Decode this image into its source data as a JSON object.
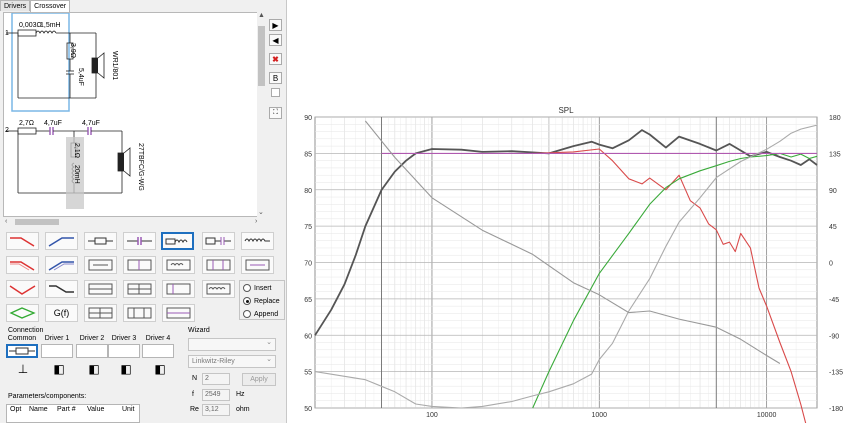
{
  "tabs": [
    {
      "label": "Drivers"
    },
    {
      "label": "Crossover"
    }
  ],
  "schematic": {
    "row1_number": "1",
    "row2_number": "2",
    "r1_label": "0,003Ω",
    "l1_label": "1,5mH",
    "r_shunt1": "3,9Ω",
    "c_shunt1": "5,4uF",
    "driver1_name": "WR1/801",
    "r2_label": "2,7Ω",
    "c2a_label": "4,7uF",
    "c2b_label": "4,7uF",
    "r_shunt2": "2,1Ω",
    "l_shunt2": "20mH",
    "driver2_name": "27TBFC/G-WG"
  },
  "radios": {
    "options": [
      {
        "label": "Insert"
      },
      {
        "label": "Replace"
      },
      {
        "label": "Append"
      }
    ],
    "selected": 1
  },
  "palette_text_button": "G(f)",
  "side_buttons": {
    "b_label": "B"
  },
  "connection": {
    "title": "Connection",
    "tabs": [
      "Common",
      "Driver 1",
      "Driver 2",
      "Driver 3",
      "Driver 4"
    ],
    "selected": 0
  },
  "wizard": {
    "title": "Wizard",
    "type_value": "",
    "filter_value": "Linkwitz-Riley",
    "n_label": "N",
    "n_value": "2",
    "apply_label": "Apply",
    "f_label": "f",
    "f_value": "2549",
    "f_unit": "Hz",
    "re_label": "Re",
    "re_value": "3,12",
    "re_unit": "ohm"
  },
  "params": {
    "title": "Parameters/components:",
    "columns": [
      "Opt",
      "Name",
      "Part #",
      "Value",
      "Unit"
    ]
  },
  "chart_data": {
    "type": "line",
    "title": "SPL",
    "xscale": "log",
    "xlim": [
      20,
      20000
    ],
    "x_tick_labels": [
      "100",
      "1000",
      "10000"
    ],
    "ylim": [
      50,
      90
    ],
    "y_ticks": [
      50,
      55,
      60,
      65,
      70,
      75,
      80,
      85,
      90
    ],
    "y2lim": [
      -180,
      180
    ],
    "y2_ticks": [
      -180,
      -135,
      -90,
      -45,
      0,
      45,
      90,
      135,
      180
    ],
    "grid": true,
    "series": [
      {
        "color": "#555555",
        "x": [
          20,
          25,
          30,
          35,
          40,
          50,
          60,
          70,
          80,
          100,
          150,
          200,
          300,
          500,
          700,
          900,
          1000,
          1200,
          1500,
          1800,
          2000,
          2500,
          3000,
          4000,
          5000,
          6000,
          7000,
          8000,
          10000,
          12000,
          14000,
          16000,
          18000,
          20000
        ],
        "y": [
          60,
          63.5,
          67,
          71,
          75,
          80,
          82.5,
          84,
          85,
          85.6,
          85.5,
          85.2,
          85.3,
          85,
          86,
          86.6,
          86.2,
          85.7,
          86.8,
          88.2,
          87.6,
          85.8,
          87.3,
          86.3,
          85.4,
          86.3,
          85.4,
          84.6,
          85.2,
          84.5,
          84,
          83.4,
          84.2,
          83.4
        ]
      },
      {
        "color": "#d94a4a",
        "x": [
          400,
          700,
          1000,
          1200,
          1500,
          1800,
          2000,
          2500,
          3000,
          3500,
          4000,
          4500,
          5000,
          5500,
          6000,
          6500,
          7000,
          8000,
          9000,
          10000,
          12000,
          14000,
          16000,
          18000
        ],
        "y": [
          85,
          85.2,
          85.6,
          84,
          81.5,
          80.8,
          81.6,
          80,
          82,
          78.5,
          77.5,
          75.3,
          74.5,
          72.5,
          72.8,
          71.5,
          74,
          72,
          66.5,
          64,
          59,
          55,
          50.5,
          46
        ]
      },
      {
        "color": "#3aaa3a",
        "x": [
          400,
          500,
          700,
          1000,
          1500,
          2000,
          2500,
          3000,
          4000,
          5000,
          6000,
          7000,
          8000,
          10000,
          12000,
          14000,
          16000,
          18000,
          20000
        ],
        "y": [
          50,
          55,
          62,
          68.5,
          74,
          78,
          80.3,
          81.5,
          82.6,
          83.3,
          83.9,
          84.3,
          84.5,
          84.7,
          85,
          84.5,
          84.9,
          84.3,
          84.6
        ]
      },
      {
        "color": "#b05ab0",
        "x": [
          50,
          100,
          200,
          500,
          700,
          1000,
          1500,
          2000,
          5000,
          10000,
          20000
        ],
        "y": [
          85,
          85,
          85,
          85,
          85,
          85,
          85,
          85,
          85,
          85,
          85
        ]
      },
      {
        "color": "#aaaaaa",
        "axis": "right",
        "x": [
          20,
          40,
          60,
          80,
          100,
          150,
          200,
          300,
          400,
          500,
          700,
          900,
          1000,
          1200,
          1500,
          2000,
          2500,
          3000,
          4000,
          5000,
          7000,
          10000,
          12000,
          14000,
          16000,
          20000
        ],
        "y": [
          -135,
          -145,
          -160,
          -175,
          -178,
          -180,
          -178,
          -172,
          -165,
          -160,
          -150,
          -138,
          -120,
          -100,
          -60,
          -20,
          20,
          50,
          80,
          105,
          125,
          140,
          150,
          160,
          165,
          170
        ]
      },
      {
        "color": "#999999",
        "axis": "right",
        "x": [
          40,
          60,
          100,
          200,
          400,
          700,
          1000,
          1500,
          2000,
          3000,
          5000,
          7000,
          10000,
          12000
        ],
        "y": [
          175,
          130,
          80,
          40,
          10,
          -25,
          -40,
          -62,
          -60,
          -70,
          -80,
          -95,
          -115,
          -125
        ]
      }
    ]
  }
}
